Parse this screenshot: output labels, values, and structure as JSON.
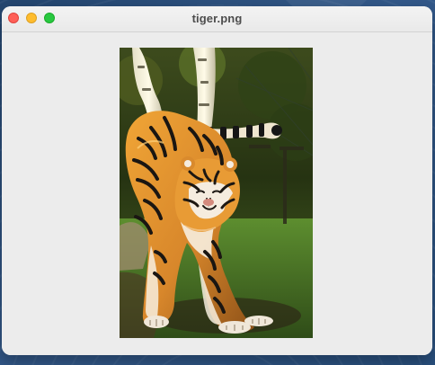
{
  "window": {
    "title": "tiger.png"
  },
  "image": {
    "subject": "tiger"
  },
  "colors": {
    "close": "#ff5f57",
    "minimize": "#febc2e",
    "maximize": "#28c840",
    "window_bg": "#ececec"
  }
}
